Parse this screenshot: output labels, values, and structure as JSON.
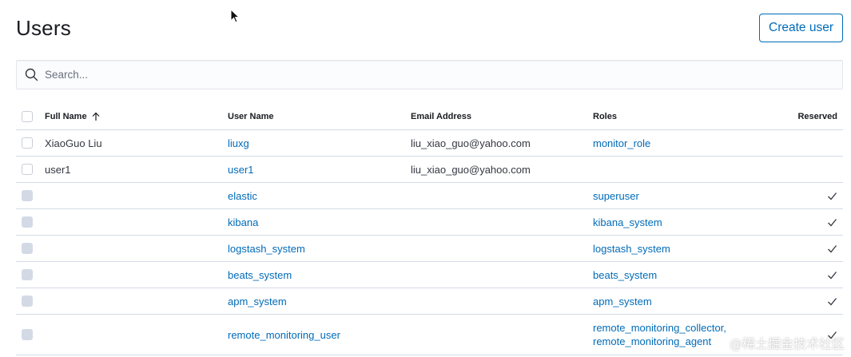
{
  "header": {
    "title": "Users",
    "create_button": "Create user"
  },
  "search": {
    "placeholder": "Search...",
    "value": ""
  },
  "table": {
    "columns": {
      "full_name": "Full Name",
      "user_name": "User Name",
      "email": "Email Address",
      "roles": "Roles",
      "reserved": "Reserved"
    },
    "sort": {
      "column": "full_name",
      "direction": "ascending"
    },
    "rows": [
      {
        "full_name": "XiaoGuo Liu",
        "user_name": "liuxg",
        "email": "liu_xiao_guo@yahoo.com",
        "roles": [
          "monitor_role"
        ],
        "reserved": false,
        "selectable": true
      },
      {
        "full_name": "user1",
        "user_name": "user1",
        "email": "liu_xiao_guo@yahoo.com",
        "roles": [],
        "reserved": false,
        "selectable": true
      },
      {
        "full_name": "",
        "user_name": "elastic",
        "email": "",
        "roles": [
          "superuser"
        ],
        "reserved": true,
        "selectable": false
      },
      {
        "full_name": "",
        "user_name": "kibana",
        "email": "",
        "roles": [
          "kibana_system"
        ],
        "reserved": true,
        "selectable": false
      },
      {
        "full_name": "",
        "user_name": "logstash_system",
        "email": "",
        "roles": [
          "logstash_system"
        ],
        "reserved": true,
        "selectable": false
      },
      {
        "full_name": "",
        "user_name": "beats_system",
        "email": "",
        "roles": [
          "beats_system"
        ],
        "reserved": true,
        "selectable": false
      },
      {
        "full_name": "",
        "user_name": "apm_system",
        "email": "",
        "roles": [
          "apm_system"
        ],
        "reserved": true,
        "selectable": false
      },
      {
        "full_name": "",
        "user_name": "remote_monitoring_user",
        "email": "",
        "roles": [
          "remote_monitoring_collector,",
          "remote_monitoring_agent"
        ],
        "reserved": true,
        "selectable": false
      }
    ]
  },
  "icons": {
    "search": "search-icon",
    "sort": "arrow-up-icon",
    "reserved": "check-icon",
    "cursor": "mouse-pointer-icon"
  },
  "colors": {
    "link": "#006bb8",
    "text": "#343741",
    "border": "#d3dae6"
  },
  "watermark": "@稀土掘金技术社区"
}
